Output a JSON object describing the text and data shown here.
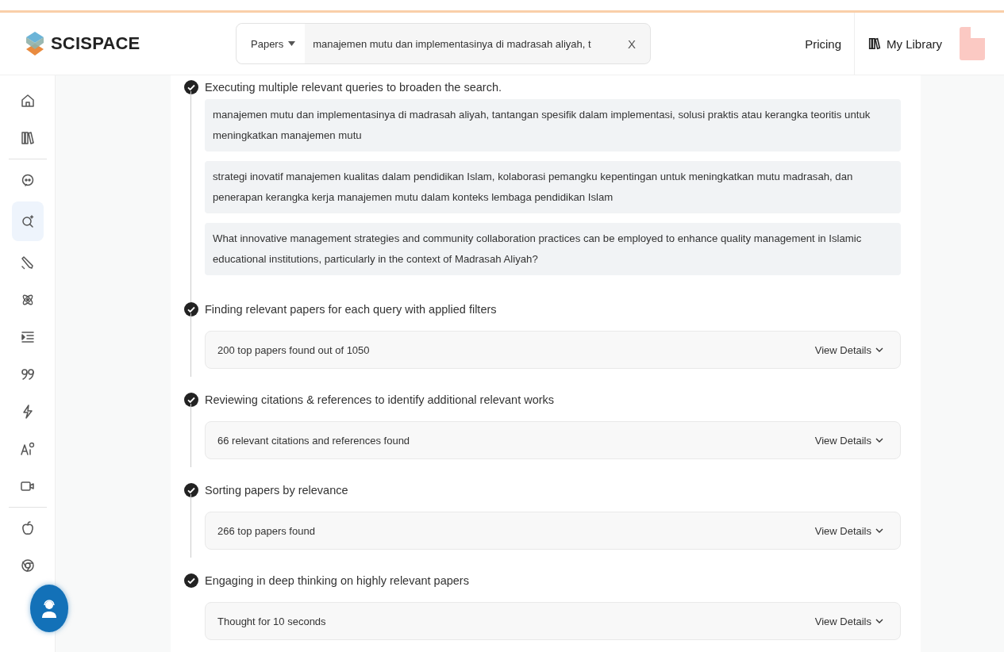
{
  "header": {
    "brand": "SCISPACE",
    "search": {
      "scope": "Papers",
      "value": "manajemen mutu dan implementasinya di madrasah aliyah, t",
      "clear": "X"
    },
    "links": [
      {
        "label": "Pricing",
        "kind": "text"
      },
      {
        "label": "My Library",
        "kind": "library"
      }
    ]
  },
  "sidebar": {
    "groups": [
      [
        {
          "kind": "home",
          "selected": false
        },
        {
          "kind": "library",
          "selected": false
        }
      ],
      [
        {
          "kind": "chat",
          "selected": false
        },
        {
          "kind": "search",
          "selected": true
        },
        {
          "kind": "pen",
          "selected": false
        },
        {
          "kind": "atom",
          "selected": false
        },
        {
          "kind": "list",
          "selected": false
        },
        {
          "kind": "quote",
          "selected": false
        },
        {
          "kind": "bolt",
          "selected": false
        },
        {
          "kind": "ai",
          "selected": false
        },
        {
          "kind": "video",
          "selected": false
        }
      ],
      [
        {
          "kind": "apple",
          "selected": false
        },
        {
          "kind": "chrome",
          "selected": false
        }
      ]
    ]
  },
  "steps": [
    {
      "title": "Executing multiple relevant queries to broaden the search.",
      "done": true,
      "kind": "queries",
      "queries": [
        "manajemen mutu dan implementasinya di madrasah aliyah, tantangan spesifik dalam implementasi, solusi praktis atau kerangka teoritis untuk meningkatkan manajemen mutu",
        "strategi inovatif manajemen kualitas dalam pendidikan Islam, kolaborasi pemangku kepentingan untuk meningkatkan mutu madrasah, dan penerapan kerangka kerja manajemen mutu dalam konteks lembaga pendidikan Islam",
        "What innovative management strategies and community collaboration practices can be employed to enhance quality management in Islamic educational institutions, particularly in the context of Madrasah Aliyah?"
      ]
    },
    {
      "title": "Finding relevant papers for each query with applied filters",
      "done": true,
      "kind": "summary",
      "summary": "200 top papers found out of 1050",
      "action": "View Details"
    },
    {
      "title": "Reviewing citations & references to identify additional relevant works",
      "done": true,
      "kind": "summary",
      "summary": "66 relevant citations and references found",
      "action": "View Details"
    },
    {
      "title": "Sorting papers by relevance",
      "done": true,
      "kind": "summary",
      "summary": "266 top papers found",
      "action": "View Details"
    },
    {
      "title": "Engaging in deep thinking on highly relevant papers",
      "done": true,
      "kind": "summary",
      "summary": "Thought for 10 seconds",
      "action": "View Details"
    }
  ]
}
